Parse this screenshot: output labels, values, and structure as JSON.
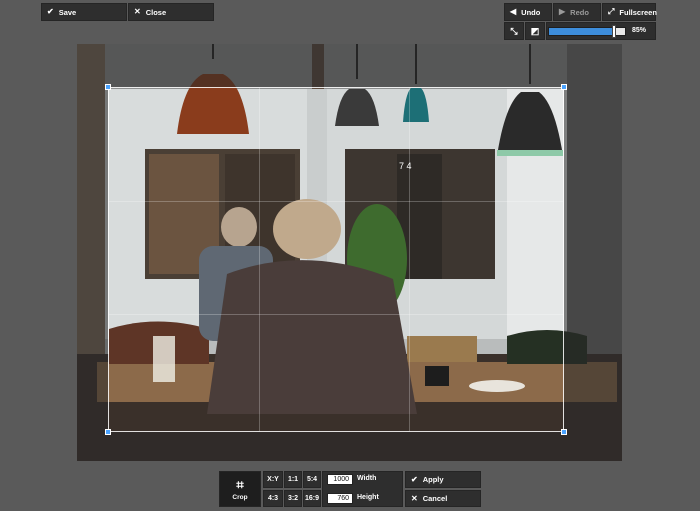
{
  "toolbar": {
    "save_label": "Save",
    "close_label": "Close",
    "undo_label": "Undo",
    "redo_label": "Redo",
    "fullscreen_label": "Fullscreen",
    "zoom_percent": 0.85,
    "zoom_label": "85%"
  },
  "crop_panel": {
    "crop_label": "Crop",
    "ratios": [
      "X:Y",
      "1:1",
      "5:4",
      "4:3",
      "3:2",
      "16:9"
    ],
    "width_value": "1000",
    "width_label": "Width",
    "height_value": "760",
    "height_label": "Height",
    "apply_label": "Apply",
    "cancel_label": "Cancel"
  },
  "photo": {
    "door_number": "7 4"
  },
  "colors": {
    "accent": "#3d8ddb",
    "handle": "#4aa3ff",
    "toolbar_bg": "#2e2e2e",
    "workspace_bg": "#5a5a5a"
  },
  "icons": {
    "save": "check-icon",
    "close": "x-icon",
    "undo": "arrow-left-icon",
    "redo": "arrow-right-icon",
    "fullscreen": "expand-icon",
    "crop": "crop-icon",
    "apply": "check-icon",
    "cancel": "x-icon"
  }
}
